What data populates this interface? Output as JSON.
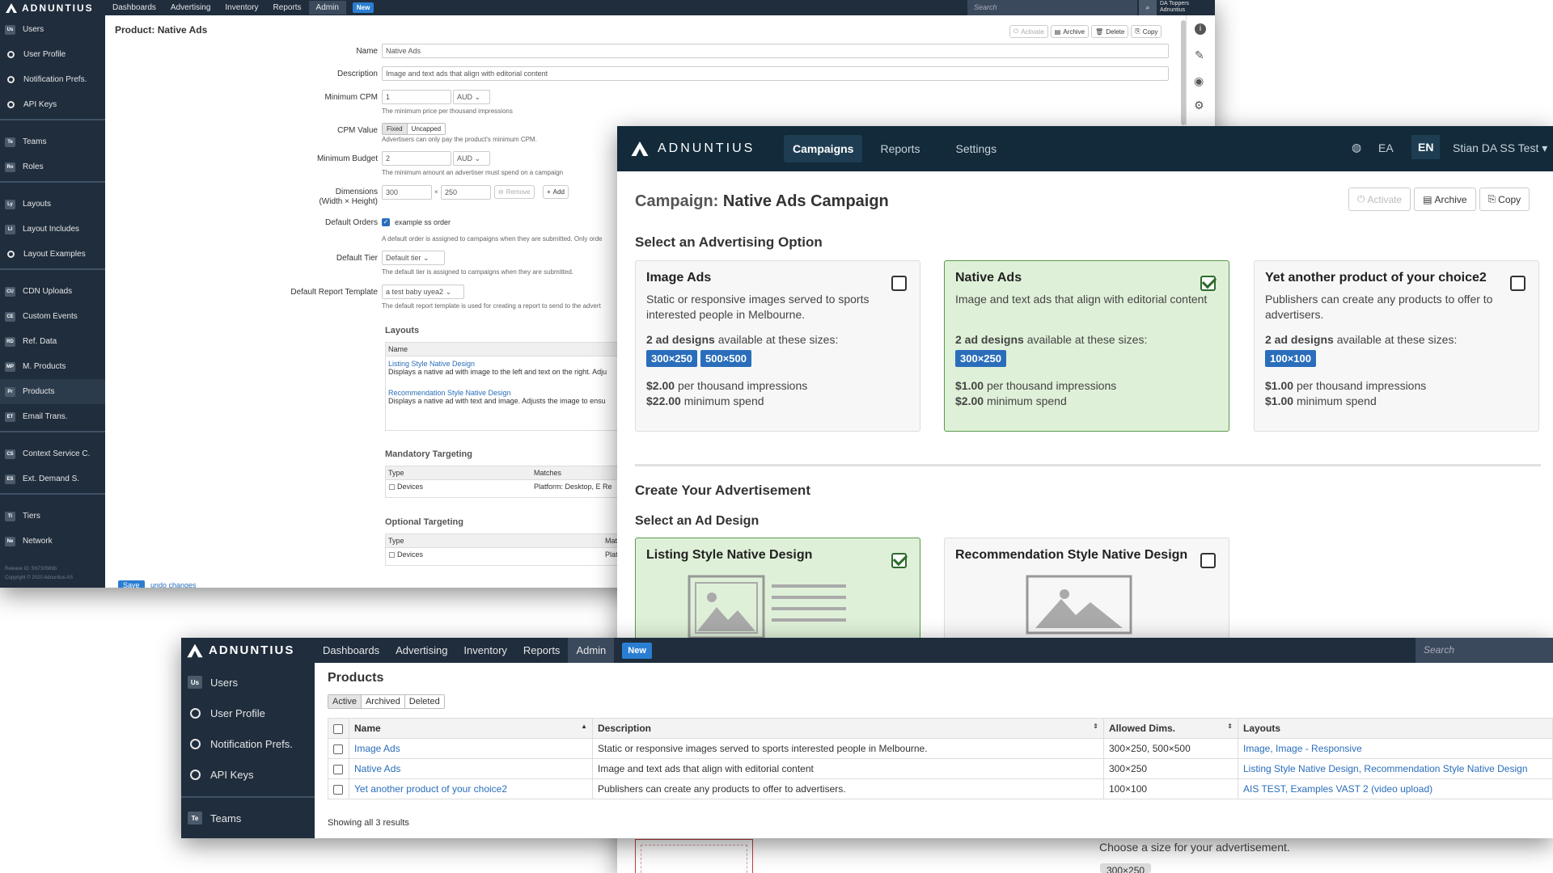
{
  "brand": "ADNUNTIUS",
  "admin_nav": [
    "Dashboards",
    "Advertising",
    "Inventory",
    "Reports",
    "Admin"
  ],
  "new_label": "New",
  "search_placeholder": "Search",
  "user_menu": {
    "line1": "DA Toppers",
    "line2": "Adnuntius"
  },
  "sidebar_groups": [
    [
      {
        "badge": "Us",
        "label": "Users"
      },
      {
        "badge": "",
        "label": "User Profile"
      },
      {
        "badge": "",
        "label": "Notification Prefs."
      },
      {
        "badge": "",
        "label": "API Keys"
      }
    ],
    [
      {
        "badge": "Te",
        "label": "Teams"
      },
      {
        "badge": "Ro",
        "label": "Roles"
      }
    ],
    [
      {
        "badge": "Ly",
        "label": "Layouts"
      },
      {
        "badge": "LI",
        "label": "Layout Includes"
      },
      {
        "badge": "",
        "label": "Layout Examples"
      }
    ],
    [
      {
        "badge": "CU",
        "label": "CDN Uploads"
      },
      {
        "badge": "CE",
        "label": "Custom Events"
      },
      {
        "badge": "RD",
        "label": "Ref. Data"
      },
      {
        "badge": "MP",
        "label": "M. Products"
      },
      {
        "badge": "Pr",
        "label": "Products"
      },
      {
        "badge": "ET",
        "label": "Email Trans."
      }
    ],
    [
      {
        "badge": "CS",
        "label": "Context Service C."
      },
      {
        "badge": "ES",
        "label": "Ext. Demand S."
      }
    ],
    [
      {
        "badge": "Ti",
        "label": "Tiers"
      },
      {
        "badge": "Ne",
        "label": "Network"
      }
    ]
  ],
  "release": {
    "id": "Release ID: 5N730569b",
    "copyright": "Copyright © 2020 Adnuntius AS"
  },
  "product_form": {
    "title_prefix": "Product:",
    "title": "Native Ads",
    "actions": [
      "Activate",
      "Archive",
      "Delete",
      "Copy"
    ],
    "name_label": "Name",
    "name_value": "Native Ads",
    "desc_label": "Description",
    "desc_value": "Image and text ads that align with editorial content",
    "min_cpm_label": "Minimum CPM",
    "min_cpm_value": "1",
    "currency": "AUD",
    "min_cpm_help": "The minimum price per thousand impressions",
    "cpm_value_label": "CPM Value",
    "cpm_fixed": "Fixed",
    "cpm_uncapped": "Uncapped",
    "cpm_value_help": "Advertisers can only pay the product's minimum CPM.",
    "min_budget_label": "Minimum Budget",
    "min_budget_value": "2",
    "min_budget_help": "The minimum amount an advertiser must spend on a campaign",
    "dims_label": "Dimensions",
    "dims_sub": "(Width × Height)",
    "dim_w": "300",
    "dim_x": "×",
    "dim_h": "250",
    "remove": "Remove",
    "add": "Add",
    "default_orders_label": "Default Orders",
    "default_order_value": "example ss order",
    "default_orders_help": "A default order is assigned to campaigns when they are submitted. Only orde",
    "default_tier_label": "Default Tier",
    "default_tier_value": "Default tier",
    "default_tier_help": "The default tier is assigned to campaigns when they are submitted.",
    "report_label": "Default Report Template",
    "report_value": "a test baby uyea2",
    "report_help": "The default report template is used for creating a report to send to the advert",
    "layouts_heading": "Layouts",
    "layouts_col": "Name",
    "layouts": [
      {
        "name": "Listing Style Native Design",
        "desc": "Displays a native ad with image to the left and text on the right. Adju"
      },
      {
        "name": "Recommendation Style Native Design",
        "desc": "Displays a native ad with text and image. Adjusts the image to ensu"
      }
    ],
    "mandatory_heading": "Mandatory Targeting",
    "type_col": "Type",
    "matches_col": "Matches",
    "mandatory_row": {
      "type": "Devices",
      "match_label": "Platform:",
      "match": "Desktop, E Re"
    },
    "optional_heading": "Optional Targeting",
    "optional_match_col": "Mat",
    "optional_row": {
      "type": "Devices",
      "match": "Plat"
    },
    "save": "Save",
    "undo": "undo changes"
  },
  "campaign": {
    "nav": [
      "Campaigns",
      "Reports",
      "Settings"
    ],
    "lang_other": "EA",
    "lang": "EN",
    "user": "Stian DA SS Test",
    "title_prefix": "Campaign:",
    "title": "Native Ads Campaign",
    "actions": [
      "Activate",
      "Archive",
      "Copy"
    ],
    "select_option_heading": "Select an Advertising Option",
    "options": [
      {
        "title": "Image Ads",
        "desc": "Static or responsive images served to sports interested people in Melbourne.",
        "designs": "2 ad designs",
        "designs_suffix": "available at these sizes:",
        "sizes": [
          "300×250",
          "500×500"
        ],
        "price": "$2.00",
        "price_suffix": "per thousand impressions",
        "min": "$22.00",
        "min_suffix": "minimum spend",
        "selected": false
      },
      {
        "title": "Native Ads",
        "desc": "Image and text ads that align with editorial content",
        "designs": "2 ad designs",
        "designs_suffix": "available at these sizes:",
        "sizes": [
          "300×250"
        ],
        "price": "$1.00",
        "price_suffix": "per thousand impressions",
        "min": "$2.00",
        "min_suffix": "minimum spend",
        "selected": true
      },
      {
        "title": "Yet another product of your choice2",
        "desc": "Publishers can create any products to offer to advertisers.",
        "designs": "2 ad designs",
        "designs_suffix": "available at these sizes:",
        "sizes": [
          "100×100"
        ],
        "price": "$1.00",
        "price_suffix": "per thousand impressions",
        "min": "$1.00",
        "min_suffix": "minimum spend",
        "selected": false
      }
    ],
    "create_heading": "Create Your Advertisement",
    "select_design_heading": "Select an Ad Design",
    "designs": [
      {
        "title": "Listing Style Native Design",
        "selected": true
      },
      {
        "title": "Recommendation Style Native Design",
        "selected": false
      }
    ],
    "size_prompt": "Choose a size for your advertisement.",
    "size_button": "300×250"
  },
  "products_list": {
    "title": "Products",
    "filters": [
      "Active",
      "Archived",
      "Deleted"
    ],
    "columns": [
      "Name",
      "Description",
      "Allowed Dims.",
      "Layouts"
    ],
    "rows": [
      {
        "name": "Image Ads",
        "desc": "Static or responsive images served to sports interested people in Melbourne.",
        "dims": "300×250, 500×500",
        "layouts": "Image, Image - Responsive"
      },
      {
        "name": "Native Ads",
        "desc": "Image and text ads that align with editorial content",
        "dims": "300×250",
        "layouts": "Listing Style Native Design, Recommendation Style Native Design"
      },
      {
        "name": "Yet another product of your choice2",
        "desc": "Publishers can create any products to offer to advertisers.",
        "dims": "100×100",
        "layouts": "AIS TEST, Examples VAST 2 (video upload)"
      }
    ],
    "footer": "Showing all 3 results",
    "sidebar": [
      {
        "badge": "Us",
        "label": "Users"
      },
      {
        "badge": "",
        "label": "User Profile"
      },
      {
        "badge": "",
        "label": "Notification Prefs."
      },
      {
        "badge": "",
        "label": "API Keys"
      },
      {
        "badge": "Te",
        "label": "Teams"
      }
    ]
  }
}
